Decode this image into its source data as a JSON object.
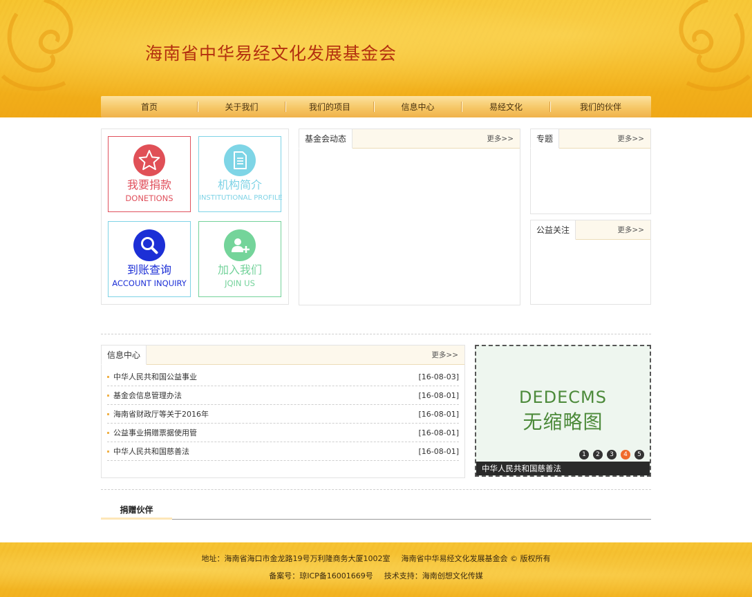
{
  "header": {
    "site_title": "海南省中华易经文化发展基金会"
  },
  "nav": {
    "items": [
      {
        "label": "首页"
      },
      {
        "label": "关于我们"
      },
      {
        "label": "我们的项目"
      },
      {
        "label": "信息中心"
      },
      {
        "label": "易经文化"
      },
      {
        "label": "我们的伙伴"
      }
    ]
  },
  "quick_links": [
    {
      "title": "我要捐款",
      "subtitle": "DONETIONS",
      "icon": "star-icon",
      "color": "#e0505c"
    },
    {
      "title": "机构简介",
      "subtitle": "INSTITUTIONAL PROFILE",
      "icon": "document-icon",
      "color": "#7ed3e6"
    },
    {
      "title": "到账查询",
      "subtitle": "ACCOUNT INQUIRY",
      "icon": "search-icon",
      "color": "#1c2fd6"
    },
    {
      "title": "加入我们",
      "subtitle": "JQIN US",
      "icon": "add-user-icon",
      "color": "#73d29a"
    }
  ],
  "panels": {
    "news": {
      "title": "基金会动态",
      "more": "更多>>"
    },
    "topic": {
      "title": "专题",
      "more": "更多>>"
    },
    "welfare": {
      "title": "公益关注",
      "more": "更多>>"
    },
    "info": {
      "title": "信息中心",
      "more": "更多>>",
      "items": [
        {
          "title": "中华人民共和国公益事业",
          "date": "[16-08-03]"
        },
        {
          "title": "基金会信息管理办法",
          "date": "[16-08-01]"
        },
        {
          "title": "海南省财政厅等关于2016年",
          "date": "[16-08-01]"
        },
        {
          "title": "公益事业捐赠票据使用管",
          "date": "[16-08-01]"
        },
        {
          "title": "中华人民共和国慈善法",
          "date": "[16-08-01]"
        }
      ]
    }
  },
  "slider": {
    "image_line1": "DEDECMS",
    "image_line2": "无缩略图",
    "pages": [
      "1",
      "2",
      "3",
      "4",
      "5"
    ],
    "active_page": "4",
    "caption": "中华人民共和国慈善法"
  },
  "partners": {
    "label": "捐赠伙伴"
  },
  "footer": {
    "address": "地址：海南省海口市金龙路19号万利隆商务大厦1002室",
    "copyright": "海南省中华易经文化发展基金会 © 版权所有",
    "icp": "备案号：琼ICP备16001669号",
    "support": "技术支持：海南创想文化传媒"
  },
  "colors": {
    "header_gold": "#f3b41c",
    "title_red": "#b3300f",
    "active_dot": "#f06a2b"
  }
}
